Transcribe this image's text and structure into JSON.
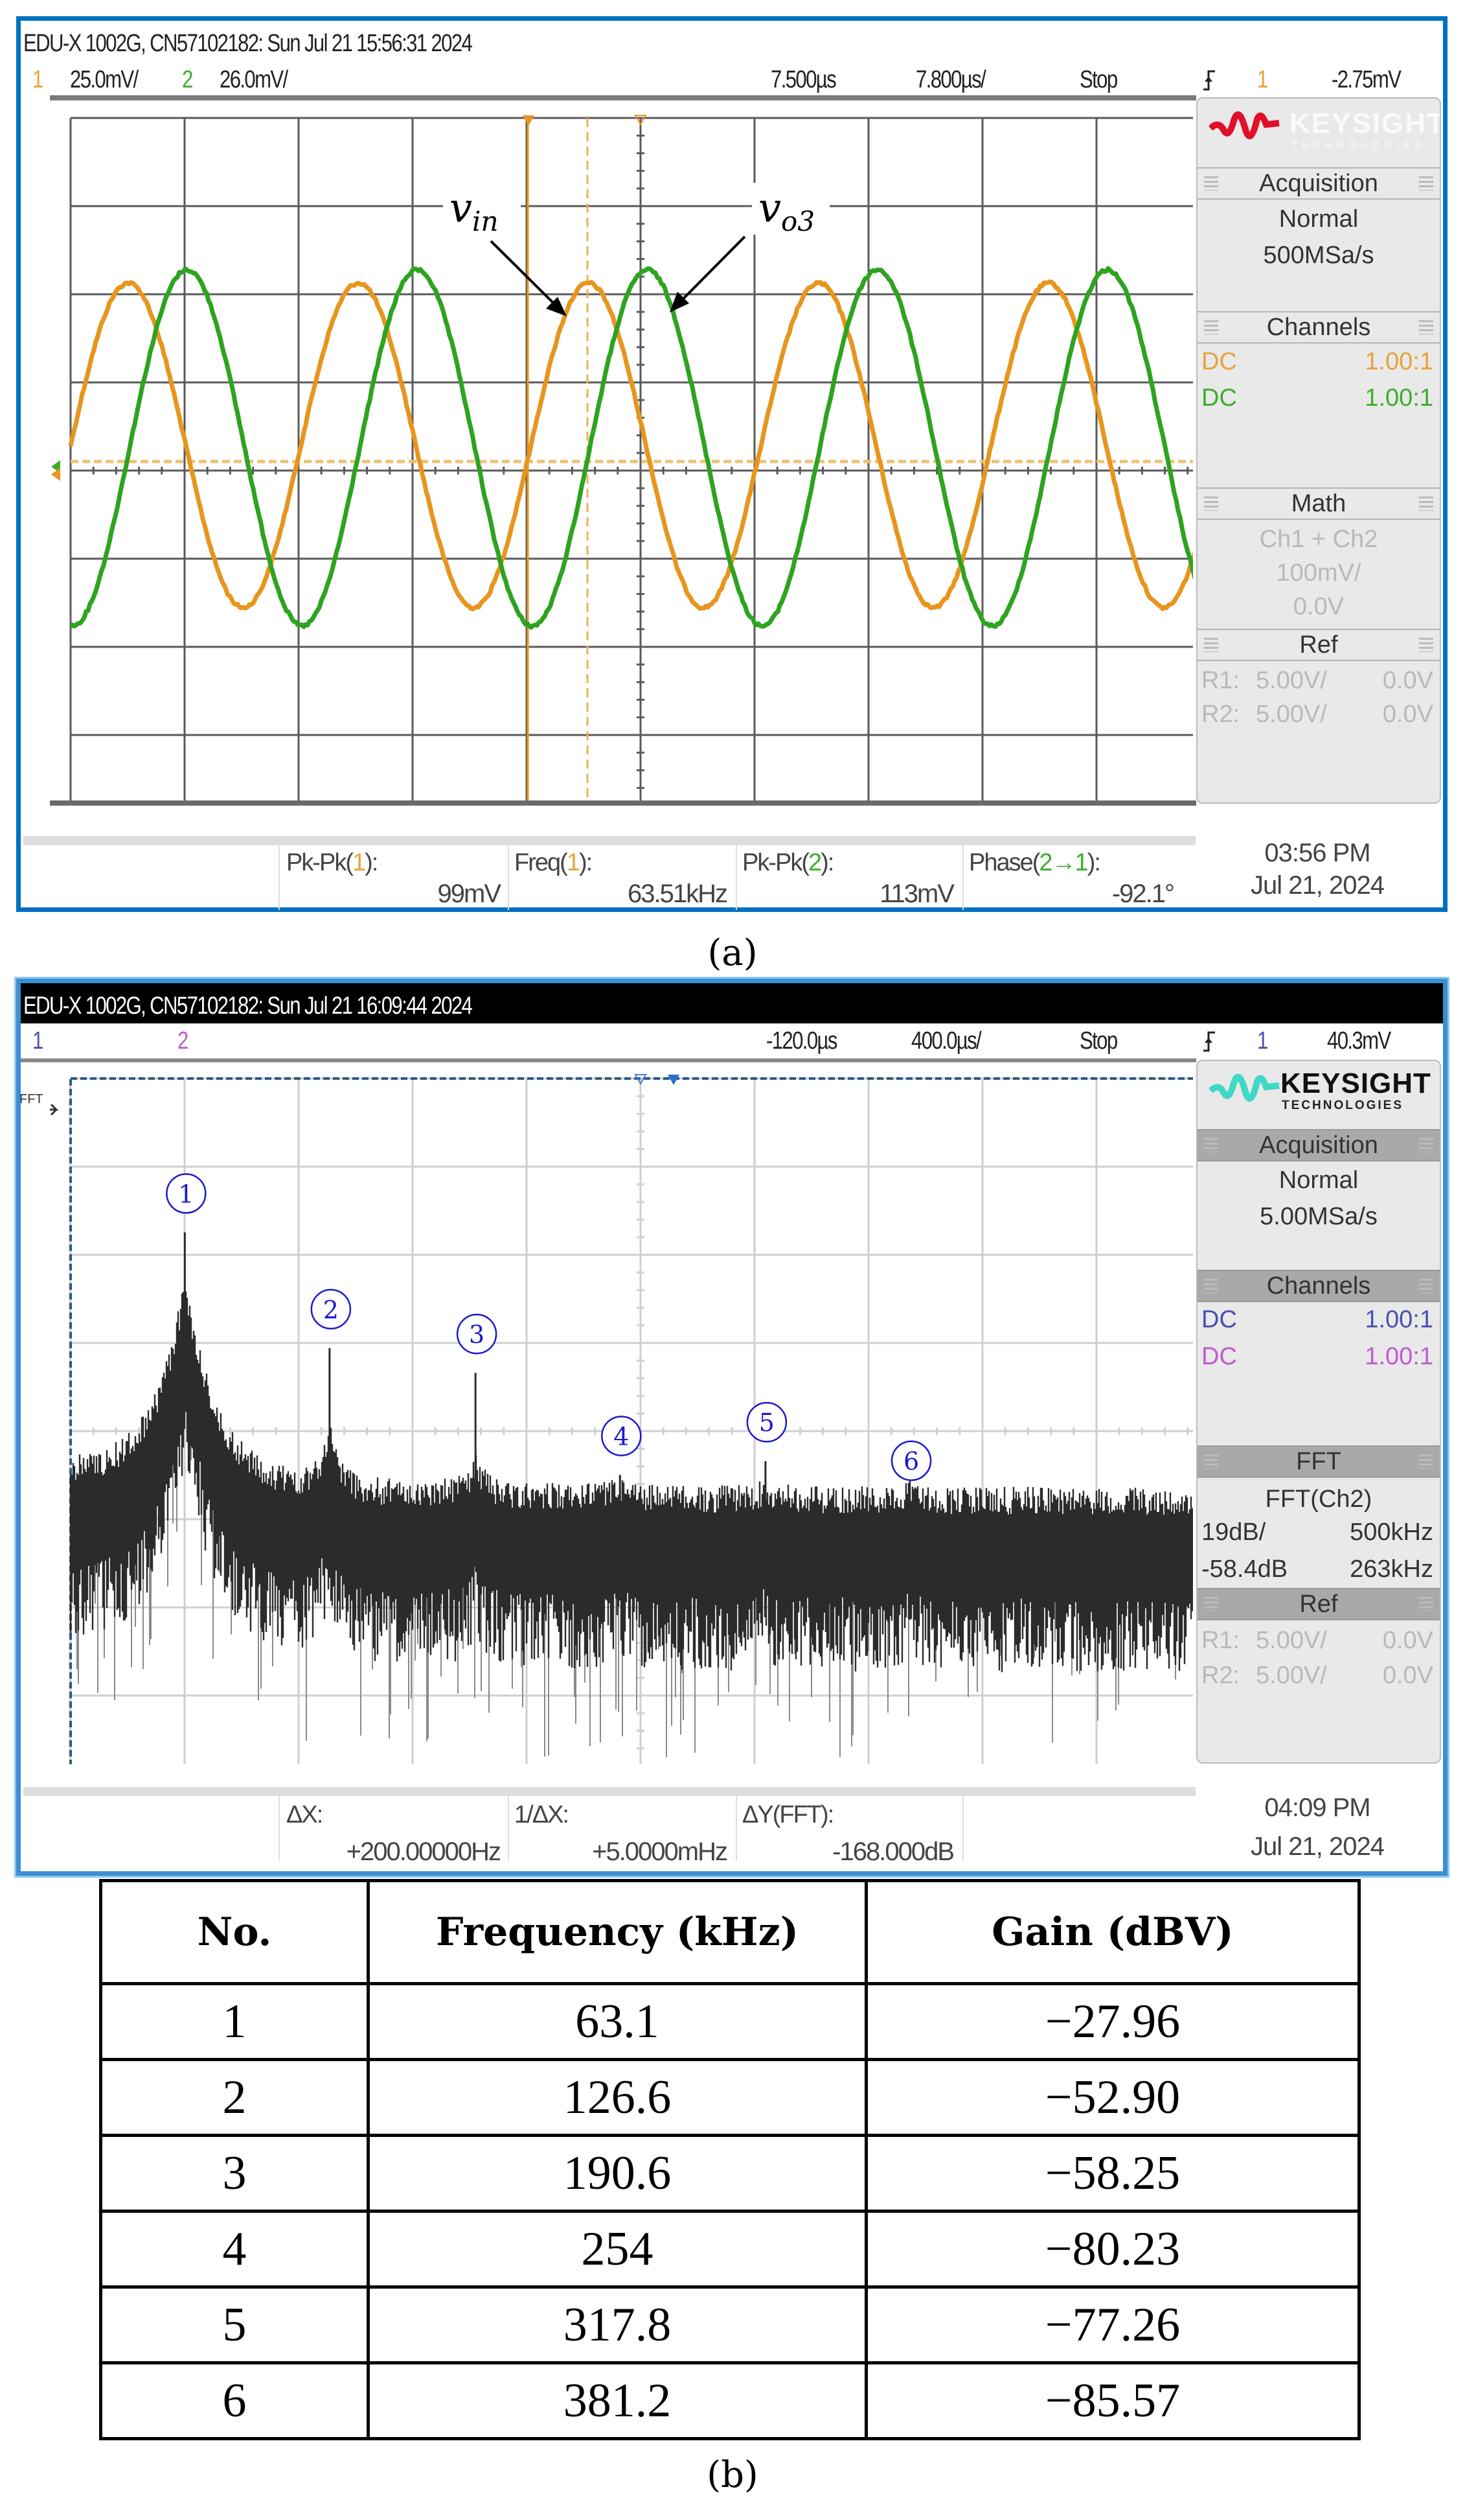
{
  "panel_a": {
    "title": "EDU-X 1002G, CN57102182: Sun Jul 21 15:56:31 2024",
    "ch1_label": "1",
    "ch1_scale": "25.0mV/",
    "ch2_label": "2",
    "ch2_scale": "26.0mV/",
    "delay": "7.500µs",
    "timebase": "7.800µs/",
    "run_state": "Stop",
    "trigger_channel": "1",
    "trigger_level": "-2.75mV",
    "brand": "KEYSIGHT",
    "brand_sub": "TECHNOLOGIES",
    "acq_header": "Acquisition",
    "acq_mode": "Normal",
    "acq_rate": "500MSa/s",
    "channels_header": "Channels",
    "channels": [
      {
        "coupling": "DC",
        "probe": "1.00:1",
        "color": "#e8a33a"
      },
      {
        "coupling": "DC",
        "probe": "1.00:1",
        "color": "#3cae2c"
      }
    ],
    "math_header": "Math",
    "math_fn": "Ch1 + Ch2",
    "math_scale": "100mV/",
    "math_offset": "0.0V",
    "ref_header": "Ref",
    "refs": [
      {
        "name": "R1:",
        "scale": "5.00V/",
        "offset": "0.0V"
      },
      {
        "name": "R2:",
        "scale": "5.00V/",
        "offset": "0.0V"
      }
    ],
    "measurements": [
      {
        "label_pre": "Pk-Pk(",
        "ch": "1",
        "label_post": "):",
        "value": "99mV"
      },
      {
        "label_pre": "Freq(",
        "ch": "1",
        "label_post": "):",
        "value": "63.51kHz"
      },
      {
        "label_pre": "Pk-Pk(",
        "ch": "2",
        "label_post": "):",
        "value": "113mV"
      },
      {
        "label_pre": "Phase(",
        "ch": "2→1",
        "label_post": "):",
        "value": "-92.1°"
      }
    ],
    "time": "03:56 PM",
    "date": "Jul 21, 2024",
    "annotations": {
      "vin": "v",
      "vin_sub": "in",
      "vo3": "v",
      "vo3_sub": "o3"
    },
    "caption": "(a)"
  },
  "panel_b": {
    "title": "EDU-X 1002G, CN57102182: Sun Jul 21 16:09:44 2024",
    "ch1_label": "1",
    "ch2_label": "2",
    "delay": "-120.0µs",
    "timebase": "400.0µs/",
    "run_state": "Stop",
    "trigger_channel": "1",
    "trigger_level": "40.3mV",
    "brand": "KEYSIGHT",
    "brand_sub": "TECHNOLOGIES",
    "acq_header": "Acquisition",
    "acq_mode": "Normal",
    "acq_rate": "5.00MSa/s",
    "channels_header": "Channels",
    "channels": [
      {
        "coupling": "DC",
        "probe": "1.00:1",
        "color": "#4a4fb0"
      },
      {
        "coupling": "DC",
        "probe": "1.00:1",
        "color": "#c05ad0"
      }
    ],
    "fft_header": "FFT",
    "fft_fn": "FFT(Ch2)",
    "fft_scale": "19dB/",
    "fft_span": "500kHz",
    "fft_ref": "-58.4dB",
    "fft_center": "263kHz",
    "ref_header": "Ref",
    "refs": [
      {
        "name": "R1:",
        "scale": "5.00V/",
        "offset": "0.0V"
      },
      {
        "name": "R2:",
        "scale": "5.00V/",
        "offset": "0.0V"
      }
    ],
    "measurements": [
      {
        "label": "ΔX:",
        "value": "+200.00000Hz"
      },
      {
        "label": "1/ΔX:",
        "value": "+5.0000mHz"
      },
      {
        "label": "ΔY(FFT):",
        "value": "-168.000dB"
      }
    ],
    "fft_marker": "FFT",
    "time": "04:09 PM",
    "date": "Jul 21, 2024",
    "caption": "(b)"
  },
  "table": {
    "headers": [
      "No.",
      "Frequency (kHz)",
      "Gain (dBV)"
    ],
    "rows": [
      [
        "1",
        "63.1",
        "−27.96"
      ],
      [
        "2",
        "126.6",
        "−52.90"
      ],
      [
        "3",
        "190.6",
        "−58.25"
      ],
      [
        "4",
        "254",
        "−80.23"
      ],
      [
        "5",
        "317.8",
        "−77.26"
      ],
      [
        "6",
        "381.2",
        "−85.57"
      ]
    ]
  },
  "chart_data": [
    {
      "type": "line",
      "title": "Oscilloscope time-domain capture",
      "x_divisions": 10,
      "y_divisions": 8,
      "time_per_div_us": 7.8,
      "frequency_kHz": 63.51,
      "series": [
        {
          "name": "vin",
          "channel": 1,
          "volts_per_div_mV": 25.0,
          "pk_pk_mV": 99,
          "phase_deg": 0,
          "color": "#e8951e"
        },
        {
          "name": "vo3",
          "channel": 2,
          "volts_per_div_mV": 26.0,
          "pk_pk_mV": 113,
          "phase_deg": -92.1,
          "color": "#2ea320"
        }
      ],
      "grid": true
    },
    {
      "type": "line",
      "title": "FFT(Ch2) spectrum",
      "xlabel": "Frequency (kHz)",
      "ylabel": "Gain (dBV)",
      "xlim": [
        13,
        513
      ],
      "ylim": [
        -146.8,
        5.2
      ],
      "db_per_div": 19,
      "peaks": [
        {
          "no": "1",
          "freq_kHz": 63.1,
          "gain_dBV": -27.96
        },
        {
          "no": "2",
          "freq_kHz": 126.6,
          "gain_dBV": -52.9
        },
        {
          "no": "3",
          "freq_kHz": 190.6,
          "gain_dBV": -58.25
        },
        {
          "no": "4",
          "freq_kHz": 254,
          "gain_dBV": -80.23
        },
        {
          "no": "5",
          "freq_kHz": 317.8,
          "gain_dBV": -77.26
        },
        {
          "no": "6",
          "freq_kHz": 381.2,
          "gain_dBV": -85.57
        }
      ],
      "noise_floor_dBV": -95,
      "grid": true,
      "trace_color": "#2b2b2b",
      "label_color": "#1a1acc"
    }
  ]
}
